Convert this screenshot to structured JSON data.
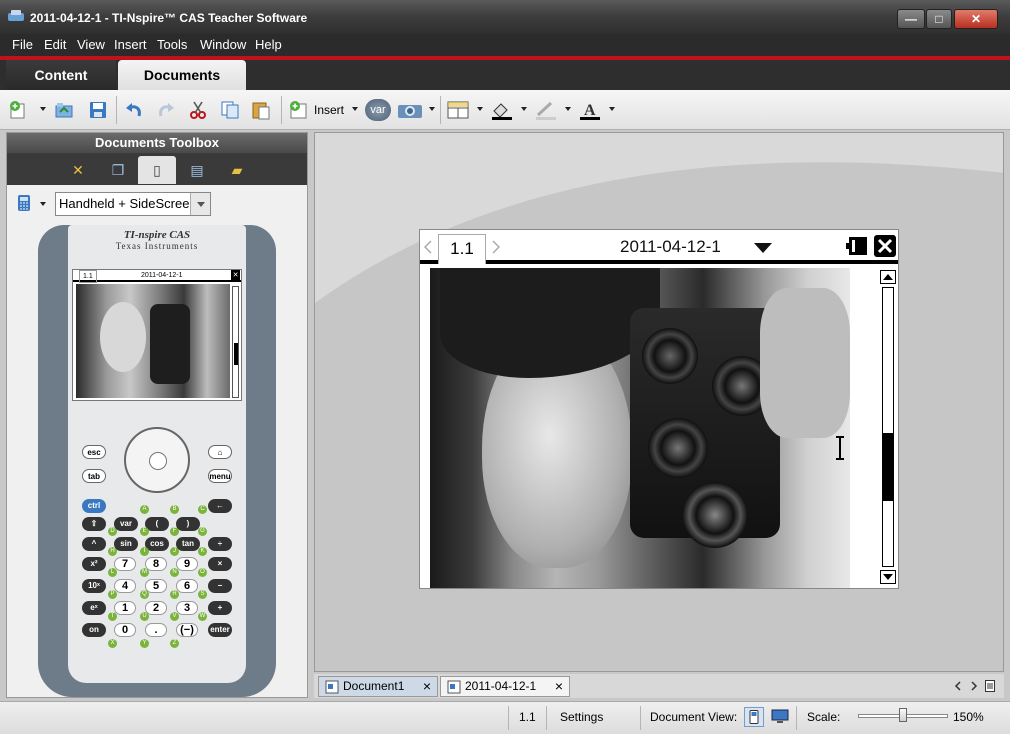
{
  "window": {
    "title": "2011-04-12-1 - TI-Nspire™ CAS Teacher Software",
    "minimize": "—",
    "maximize": "□",
    "close": "✕"
  },
  "menu": [
    "File",
    "Edit",
    "View",
    "Insert",
    "Tools",
    "Window",
    "Help"
  ],
  "main_tabs": [
    {
      "label": "Content",
      "active": false
    },
    {
      "label": "Documents",
      "active": true
    }
  ],
  "toolbar": {
    "insert_label": "Insert",
    "var_label": "var",
    "icons": [
      "new-document-icon",
      "open-document-icon",
      "save-icon",
      "undo-icon",
      "redo-icon",
      "cut-icon",
      "copy-icon",
      "paste-icon",
      "insert-page-icon",
      "var-icon",
      "screen-capture-icon",
      "page-layout-icon",
      "fill-color-icon",
      "line-color-icon",
      "text-color-icon"
    ]
  },
  "toolbox": {
    "title": "Documents Toolbox",
    "tabs": [
      "tools-icon",
      "page-sorter-icon",
      "handheld-icon",
      "utilities-icon",
      "content-explorer-icon"
    ],
    "active_tab": 2,
    "view_option": "Handheld + SideScreen"
  },
  "handheld": {
    "brand_line1": "TI-nspire CAS",
    "brand_line2": "Texas Instruments",
    "mini_tab": "1.1",
    "mini_doc": "2011-04-12-1",
    "keys": {
      "esc": "esc",
      "tab": "tab",
      "menu": "menu",
      "home": "⌂",
      "ctrl": "ctrl",
      "del": "←",
      "shift": "⇧",
      "var": "var",
      "paren_open": "(",
      "paren_close": ")",
      "sin": "sin",
      "cos": "cos",
      "tan": "tan",
      "caret": "^",
      "x2": "x²",
      "tenx": "10ˣ",
      "ex": "eˣ",
      "on": "on",
      "times": "×",
      "minus": "−",
      "plus": "+",
      "divide": "÷",
      "enter": "enter",
      "neg": "(−)",
      "dot": "."
    },
    "digits": [
      "7",
      "8",
      "9",
      "4",
      "5",
      "6",
      "1",
      "2",
      "3",
      "0"
    ],
    "letters": [
      "A",
      "B",
      "C",
      "D",
      "E",
      "F",
      "G",
      "H",
      "I",
      "J",
      "K",
      "L",
      "M",
      "N",
      "O",
      "P",
      "Q",
      "R",
      "S",
      "T",
      "U",
      "V",
      "W",
      "X",
      "Y",
      "Z"
    ]
  },
  "document": {
    "page_tab": "1.1",
    "doc_name": "2011-04-12-1"
  },
  "doc_tabs": [
    {
      "label": "Document1",
      "close": "×"
    },
    {
      "label": "2011-04-12-1",
      "close": "×"
    }
  ],
  "status": {
    "page": "1.1",
    "settings": "Settings",
    "document_view_label": "Document View:",
    "scale_label": "Scale:",
    "scale_value": "150%",
    "scale_fraction": 0.5
  },
  "colors": {
    "accent_red": "#c0121a",
    "active_tab": "#ececec",
    "highlight_blue": "#3b78c2",
    "key_green": "#7ab43a"
  }
}
